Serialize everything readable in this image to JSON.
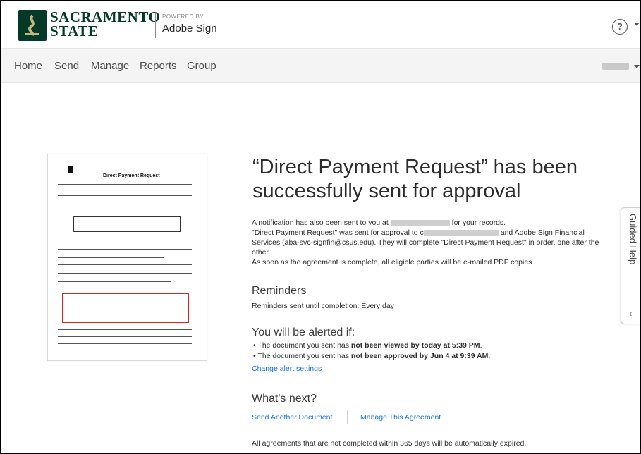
{
  "header": {
    "brand_line1": "SACRAMENTO",
    "brand_line2": "STATE",
    "powered_by": "POWERED BY",
    "product": "Adobe Sign",
    "help_icon": "question-circle-icon",
    "help_glyph": "?"
  },
  "nav": {
    "items": [
      "Home",
      "Send",
      "Manage",
      "Reports",
      "Group"
    ]
  },
  "thumbnail": {
    "title": "Direct Payment Request"
  },
  "main": {
    "headline_line1": "“Direct Payment Request” has been",
    "headline_line2": "successfully sent for approval",
    "notify_pre": "A notification has also been sent to you at",
    "notify_post": "for your records.",
    "sent_pre": "\"Direct Payment Request\" was sent for approval to c",
    "sent_post": "and Adobe Sign Financial",
    "sent_line2": "Services (aba-svc-signfin@csus.edu). They will complete \"Direct Payment Request\" in order, one after the",
    "sent_line3": "other.",
    "complete_note": "As soon as the agreement is complete, all eligible parties will be e-mailed PDF copies.",
    "reminders_heading": "Reminders",
    "reminders_text": "Reminders sent until completion: Every day",
    "alert_heading": "You will be alerted if:",
    "alert1_pre": "The document you sent has ",
    "alert1_bold": "not been viewed by today at 5:39 PM",
    "alert1_post": ".",
    "alert2_pre": "The document you sent has ",
    "alert2_bold": "not been approved by Jun 4 at 9:39 AM",
    "alert2_post": ".",
    "change_alerts_link": "Change alert settings",
    "next_heading": "What's next?",
    "send_another_link": "Send Another Document",
    "manage_link": "Manage This Agreement",
    "expiry_note": "All agreements that are not completed within 365 days will be automatically expired."
  },
  "guided_help": {
    "label": "Guided Help",
    "chevron": "‹"
  },
  "colors": {
    "brand_green": "#043927",
    "link_blue": "#1473e6",
    "nav_bg": "#f4f4f4"
  }
}
